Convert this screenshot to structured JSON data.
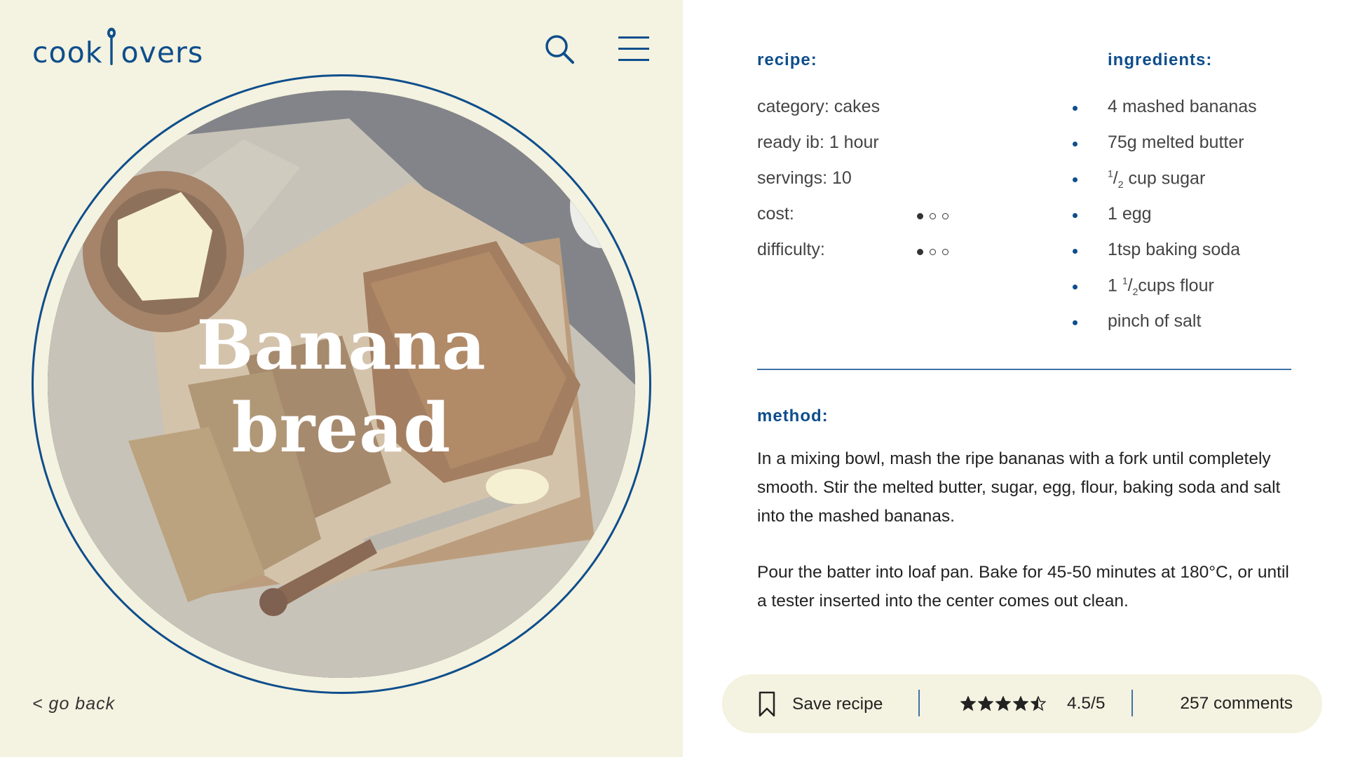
{
  "header": {
    "logo_left": "cook",
    "logo_right": "overs",
    "search_icon": "search-icon",
    "menu_icon": "menu-icon"
  },
  "hero": {
    "title_line1": "Banana",
    "title_line2": "bread"
  },
  "nav": {
    "go_back": "< go back"
  },
  "recipe": {
    "heading": "recipe:",
    "category": "category: cakes",
    "ready": "ready ib: 1 hour",
    "servings": "servings: 10",
    "cost_label": "cost:",
    "cost_level": 1,
    "difficulty_label": "difficulty:",
    "difficulty_level": 1,
    "level_max": 3
  },
  "ingredients": {
    "heading": "ingredients:",
    "items": [
      "4 mashed bananas",
      "75g melted butter",
      "cup sugar",
      "1 egg",
      "1tsp baking soda",
      "cups flour",
      "pinch of salt"
    ],
    "frac_num": "1",
    "frac_den": "2",
    "flour_whole": "1"
  },
  "method": {
    "heading": "method:",
    "paragraphs": [
      "In a mixing bowl, mash the ripe bananas with a fork until completely smooth. Stir the melted butter, sugar, egg, flour, baking soda and salt into the mashed bananas.",
      "Pour the batter into loaf pan. Bake for 45-50 minutes at 180°C, or until a tester inserted into the center comes out clean."
    ]
  },
  "actions": {
    "save_label": "Save recipe",
    "bookmark_icon": "bookmark-icon",
    "rating_value": 4.5,
    "rating_text": "4.5/5",
    "comments_text": "257 comments"
  },
  "colors": {
    "accent": "#0e4e8c",
    "panel_bg": "#f4f2e0",
    "text": "#333333"
  }
}
